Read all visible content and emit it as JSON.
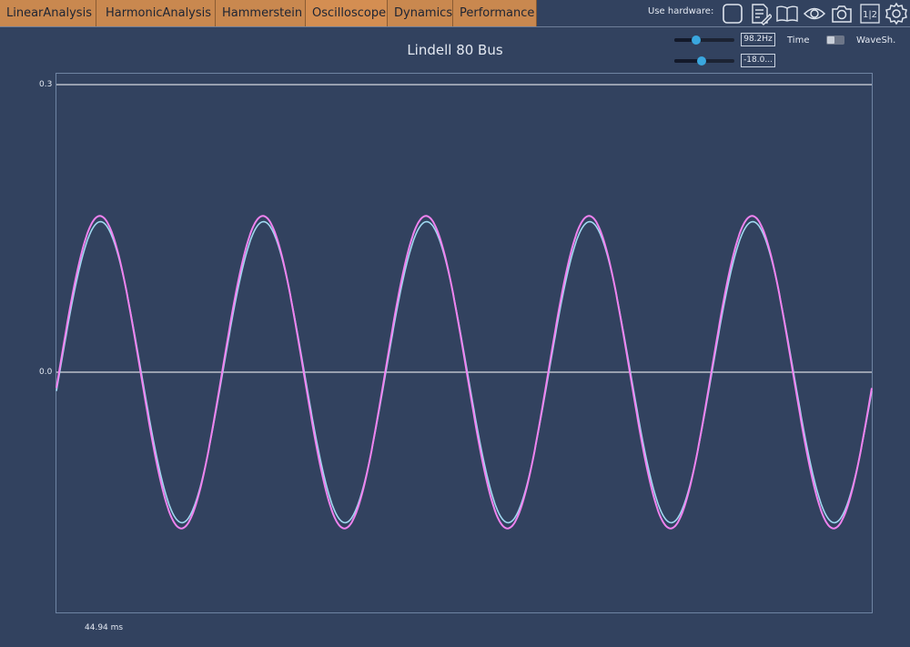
{
  "tabs": [
    {
      "label": "LinearAnalysis"
    },
    {
      "label": "HarmonicAnalysis"
    },
    {
      "label": "Hammerstein"
    },
    {
      "label": "Oscilloscope"
    },
    {
      "label": "Dynamics"
    },
    {
      "label": "Performance"
    }
  ],
  "active_tab": "Oscilloscope",
  "toolbar": {
    "hardware_label": "Use hardware:",
    "icons": [
      "checkbox-icon",
      "notes-icon",
      "book-icon",
      "eye-icon",
      "camera-icon",
      "channel-split-icon",
      "gear-icon"
    ],
    "split_label": "1|2"
  },
  "controls": {
    "frequency": {
      "value": "98.2Hz",
      "slider_level": 0.36
    },
    "level": {
      "value": "-18.0...",
      "slider_level": 0.46
    },
    "time_label": "Time",
    "waveshaper_label": "WaveSh.",
    "waveshaper_on": false
  },
  "colors": {
    "background": "#32425f",
    "tab": "#c9884f",
    "reference_line": "#ffffff",
    "trace_pink": "#ee82ee",
    "trace_cyan": "#9fd8f0",
    "accent": "#3aa7df"
  },
  "plot": {
    "title": "Lindell 80 Bus",
    "y_ticks": [
      "0.3",
      "0.0"
    ],
    "time_readout": "44.94 ms"
  },
  "chart_data": {
    "type": "line",
    "title": "Lindell 80 Bus",
    "xlabel": "",
    "ylabel": "",
    "x_unit": "ms",
    "xlim": [
      0,
      44.94
    ],
    "ylim": [
      -0.3,
      0.3
    ],
    "y_ticks": [
      0.3,
      0.0
    ],
    "reference_lines": [
      0.3,
      0.0
    ],
    "grid": false,
    "legend": "none",
    "series": [
      {
        "color": "#9fd8f0",
        "waveform": "sine",
        "amplitude": 0.157,
        "cycles": 5.0,
        "phase_deg": -7.2
      },
      {
        "color": "#ee82ee",
        "waveform": "sine",
        "amplitude": 0.163,
        "cycles": 5.0,
        "phase_deg": -5.8
      }
    ]
  }
}
